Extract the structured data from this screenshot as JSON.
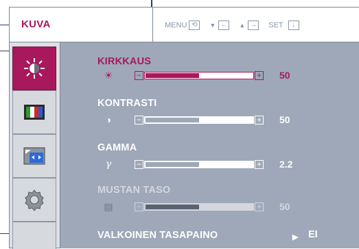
{
  "header": {
    "title": "KUVA",
    "hints": [
      {
        "label": "MENU",
        "key_glyph": "⟲",
        "icon": "menu-key-icon",
        "prefix": ""
      },
      {
        "label": "",
        "key_glyph": "←",
        "icon": "left-arrow-key-icon",
        "prefix": "▼"
      },
      {
        "label": "",
        "key_glyph": "→",
        "icon": "right-arrow-key-icon",
        "prefix": "▲"
      },
      {
        "label": "SET",
        "key_glyph": "↓",
        "icon": "set-key-icon",
        "prefix": ""
      }
    ]
  },
  "sidebar": {
    "items": [
      {
        "icon": "brightness-icon",
        "active": true
      },
      {
        "icon": "color-bars-icon",
        "active": false
      },
      {
        "icon": "screen-adjust-icon",
        "active": false
      },
      {
        "icon": "gear-icon",
        "active": false
      },
      {
        "icon": "empty-slot",
        "active": false
      }
    ]
  },
  "settings": {
    "brightness": {
      "label": "KIRKKAUS",
      "icon": "sun-icon",
      "glyph": "☀",
      "value": "50",
      "level": 0.5
    },
    "contrast": {
      "label": "KONTRASTI",
      "icon": "contrast-icon",
      "glyph": "◑",
      "value": "50",
      "level": 0.5
    },
    "gamma": {
      "label": "GAMMA",
      "icon": "gamma-icon",
      "glyph": "γ",
      "value": "2.2",
      "level": 0.5
    },
    "black_level": {
      "label": "MUSTAN TASO",
      "icon": "black-level-icon",
      "glyph": "▤",
      "value": "50",
      "level": 0.5
    },
    "white_balance": {
      "label": "VALKOINEN TASAPAINO",
      "value": "EI"
    }
  },
  "colors": {
    "accent": "#a8185c",
    "panel": "#9ea8b8",
    "sidebar": "#dcdfe4"
  }
}
